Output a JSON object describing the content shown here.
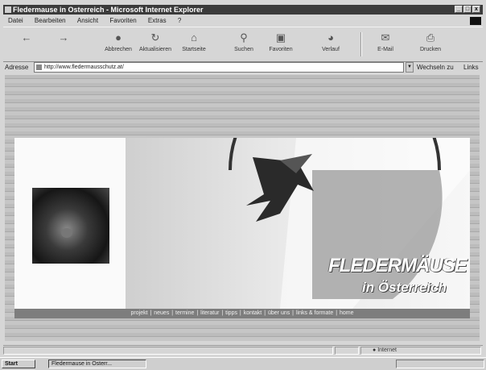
{
  "window": {
    "title": "Fledermause in Osterreich - Microsoft Internet Explorer",
    "min_label": "_",
    "max_label": "□",
    "close_label": "x"
  },
  "menu": [
    "Datei",
    "Bearbeiten",
    "Ansicht",
    "Favoriten",
    "Extras",
    "?"
  ],
  "toolbar": [
    {
      "label": "",
      "icon": "back-icon"
    },
    {
      "label": "",
      "icon": "forward-icon"
    },
    {
      "label": "Abbrechen",
      "icon": "stop-icon"
    },
    {
      "label": "Aktualisieren",
      "icon": "refresh-icon"
    },
    {
      "label": "Startseite",
      "icon": "home-icon"
    },
    {
      "label": "Suchen",
      "icon": "search-icon"
    },
    {
      "label": "Favoriten",
      "icon": "favorites-icon"
    },
    {
      "label": "Verlauf",
      "icon": "history-icon"
    },
    {
      "label": "E-Mail",
      "icon": "mail-icon"
    },
    {
      "label": "Drucken",
      "icon": "print-icon"
    }
  ],
  "address": {
    "label": "Adresse",
    "url": "http://www.fledermausschutz.at/",
    "go_label": "Wechseln zu",
    "links_label": "Links"
  },
  "banner": {
    "title_line1": "FLEDERMÄUSE",
    "title_line2": "in Österreich"
  },
  "nav": [
    "projekt",
    "neues",
    "termine",
    "literatur",
    "tipps",
    "kontakt",
    "über uns",
    "links & formate",
    "home"
  ],
  "status": {
    "zone": "Internet"
  },
  "taskbar": {
    "start": "Start",
    "task": "Fledermause in Osterr...",
    "clock": ""
  }
}
